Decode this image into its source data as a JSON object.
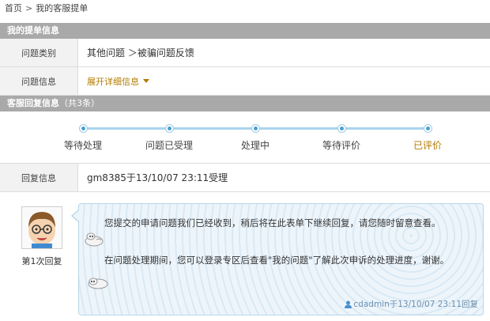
{
  "breadcrumb": {
    "home": "首页",
    "separator": ">",
    "current": "我的客服提单"
  },
  "ticket_section": {
    "title": "我的提单信息",
    "category_label": "问题类别",
    "category_value": "其他问题 ＞被骗问题反馈",
    "info_label": "问题信息",
    "expand_label": "展开详细信息"
  },
  "reply_section": {
    "title": "客服回复信息",
    "count_text": "（共3条）"
  },
  "progress": {
    "steps": [
      "等待处理",
      "问题已受理",
      "处理中",
      "等待评价",
      "已评价"
    ]
  },
  "reply_info": {
    "label": "回复信息",
    "value": "gm8385于13/10/07 23:11受理"
  },
  "message": {
    "reply_number": "第1次回复",
    "line1": "您提交的申请问题我们已经收到，稍后将在此表单下继续回复，请您随时留意查看。",
    "line2": "在问题处理期间，您可以登录专区后查看\"我的问题\"了解此次申诉的处理进度，谢谢。",
    "signature": "cdadmin于13/10/07 23:11回复"
  },
  "colors": {
    "accent": "#b37a00",
    "bar": "#a9a9a9",
    "progress": "#a8d4ee",
    "bubble": "#edf5fb"
  }
}
